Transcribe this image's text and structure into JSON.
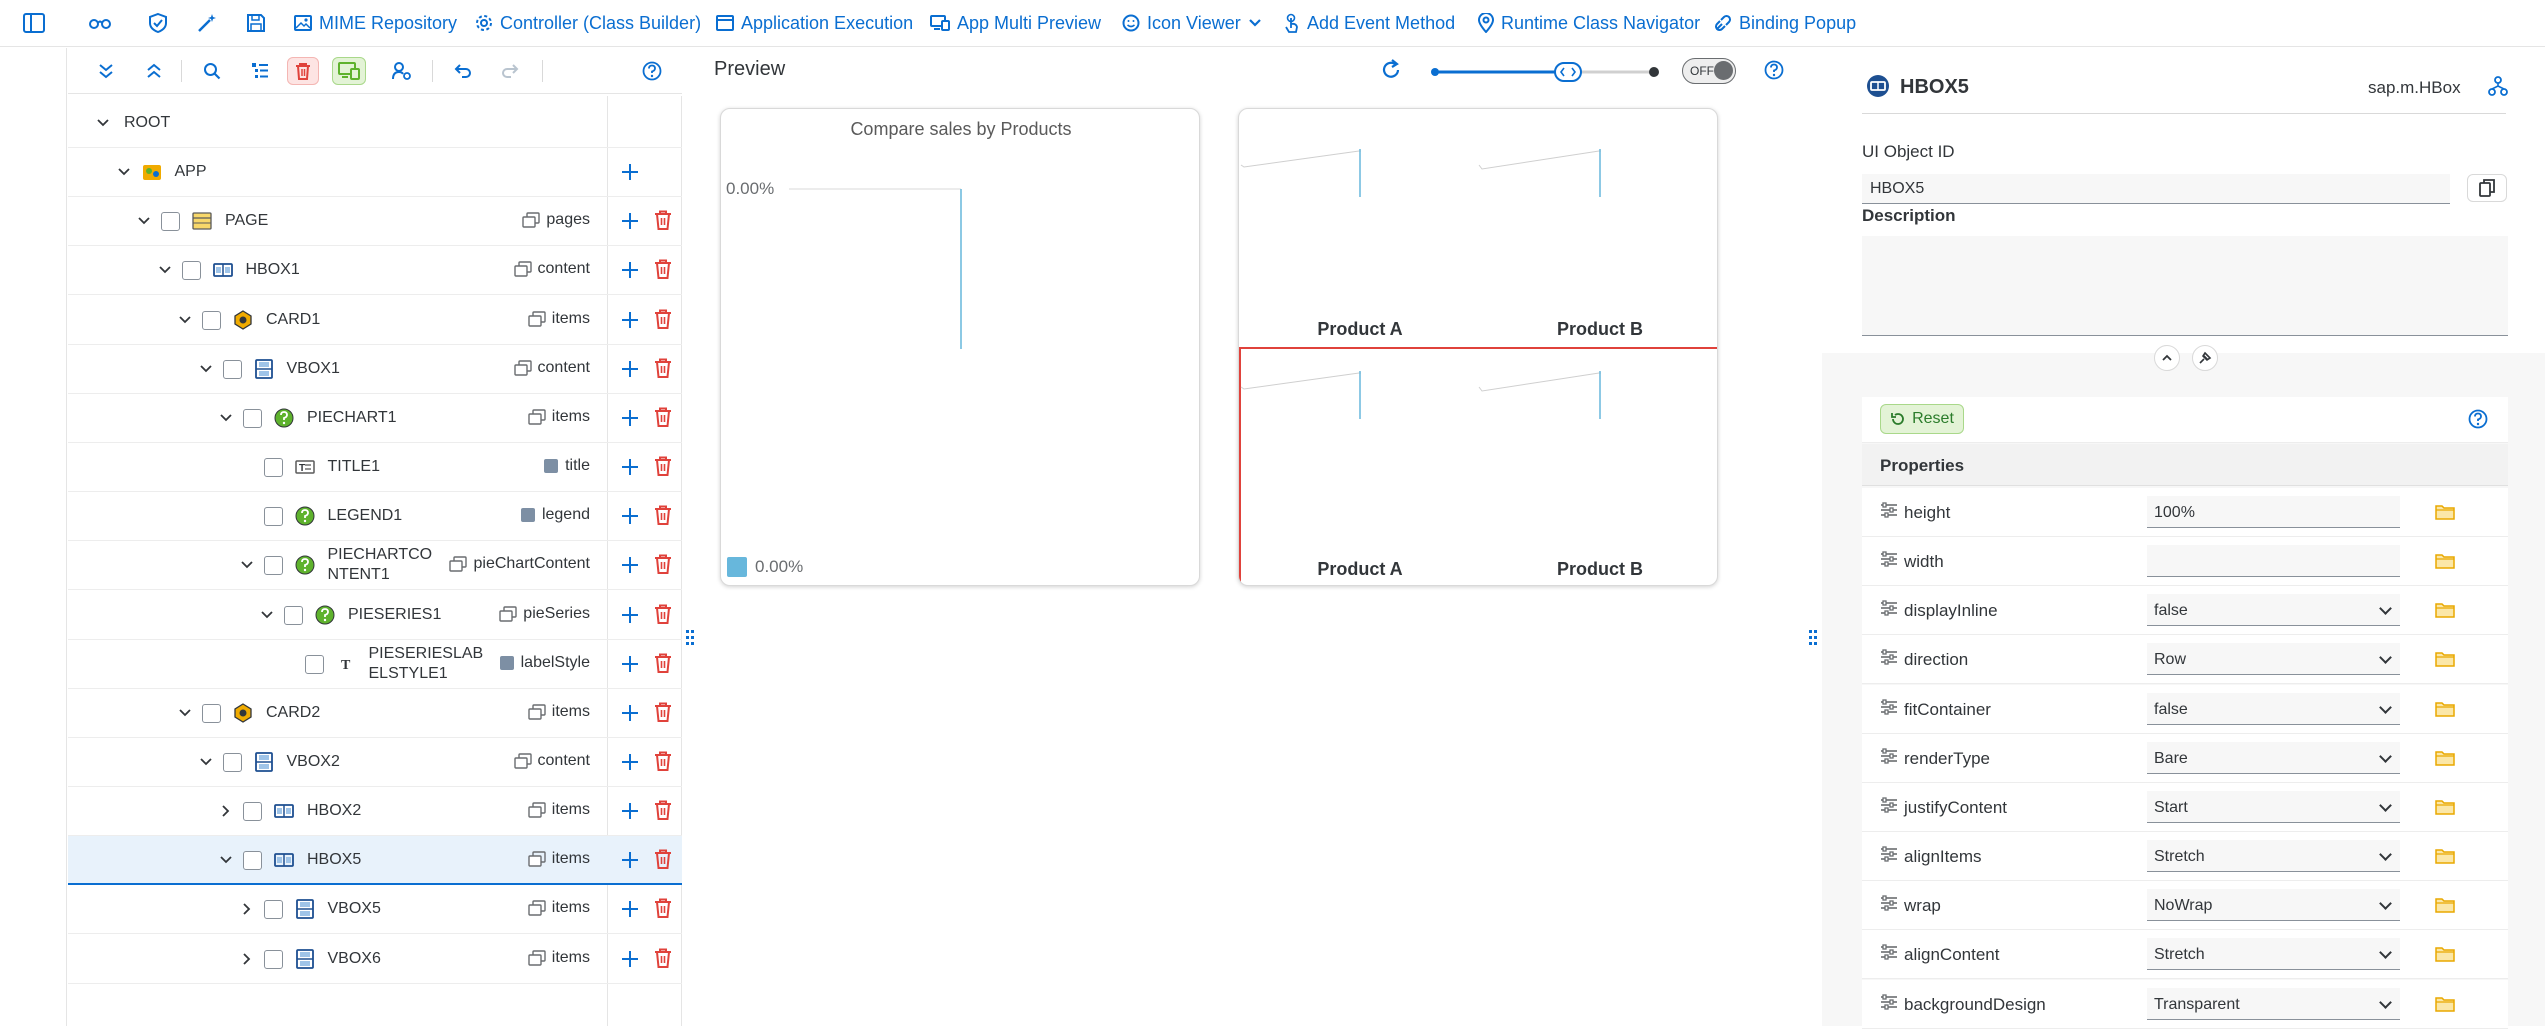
{
  "colors": {
    "brand": "#0a6ed1",
    "danger": "#e0423b",
    "green": "#5eb22d",
    "selected_bg": "#e8f2fb"
  },
  "toolbar": {
    "items": [
      {
        "label": "MIME Repository",
        "icon": "image-icon"
      },
      {
        "label": "Controller (Class Builder)",
        "icon": "gear-icon"
      },
      {
        "label": "Application Execution",
        "icon": "window-icon"
      },
      {
        "label": "App Multi Preview",
        "icon": "devices-icon"
      },
      {
        "label": "Icon Viewer",
        "icon": "smiley-icon"
      },
      {
        "label": "Add Event Method",
        "icon": "touch-icon"
      },
      {
        "label": "Runtime Class Navigator",
        "icon": "location-icon"
      },
      {
        "label": "Binding Popup",
        "icon": "link-icon"
      }
    ]
  },
  "tree": {
    "rows": [
      {
        "name": "ROOT",
        "agg": ""
      },
      {
        "name": "APP",
        "agg": ""
      },
      {
        "name": "PAGE",
        "agg": "pages"
      },
      {
        "name": "HBOX1",
        "agg": "content"
      },
      {
        "name": "CARD1",
        "agg": "items"
      },
      {
        "name": "VBOX1",
        "agg": "content"
      },
      {
        "name": "PIECHART1",
        "agg": "items"
      },
      {
        "name": "TITLE1",
        "agg": "title"
      },
      {
        "name": "LEGEND1",
        "agg": "legend"
      },
      {
        "name": "PIECHARTCONTENT1",
        "name_l1": "PIECHARTCO",
        "name_l2": "NTENT1",
        "agg": "pieChartContent"
      },
      {
        "name": "PIESERIES1",
        "agg": "pieSeries"
      },
      {
        "name": "PIESERIESLABELSTYLE1",
        "name_l1": "PIESERIESLAB",
        "name_l2": "ELSTYLE1",
        "agg": "labelStyle"
      },
      {
        "name": "CARD2",
        "agg": "items"
      },
      {
        "name": "VBOX2",
        "agg": "content"
      },
      {
        "name": "HBOX2",
        "agg": "items"
      },
      {
        "name": "HBOX5",
        "agg": "items"
      },
      {
        "name": "VBOX5",
        "agg": "items"
      },
      {
        "name": "VBOX6",
        "agg": "items"
      }
    ]
  },
  "preview": {
    "title": "Preview",
    "toggle": "OFF",
    "card1": {
      "title": "Compare sales by Products",
      "axis_label": "0.00%",
      "legend_label": "0.00%"
    },
    "card2": {
      "labels": [
        "Product A",
        "Product B",
        "Product A",
        "Product B"
      ]
    }
  },
  "chart_data": {
    "type": "pie",
    "title": "Compare sales by Products",
    "categories": [
      "0.00%"
    ],
    "values": [
      0.0
    ]
  },
  "details": {
    "object_name": "HBOX5",
    "object_class": "sap.m.HBox",
    "ui_object_id_label": "UI Object ID",
    "ui_object_id_value": "HBOX5",
    "description_label": "Description",
    "description_value": "",
    "reset_label": "Reset",
    "properties_label": "Properties",
    "properties": [
      {
        "name": "height",
        "value": "100%",
        "type": "input"
      },
      {
        "name": "width",
        "value": "",
        "type": "input"
      },
      {
        "name": "displayInline",
        "value": "false",
        "type": "select"
      },
      {
        "name": "direction",
        "value": "Row",
        "type": "select"
      },
      {
        "name": "fitContainer",
        "value": "false",
        "type": "select"
      },
      {
        "name": "renderType",
        "value": "Bare",
        "type": "select"
      },
      {
        "name": "justifyContent",
        "value": "Start",
        "type": "select"
      },
      {
        "name": "alignItems",
        "value": "Stretch",
        "type": "select"
      },
      {
        "name": "wrap",
        "value": "NoWrap",
        "type": "select"
      },
      {
        "name": "alignContent",
        "value": "Stretch",
        "type": "select"
      },
      {
        "name": "backgroundDesign",
        "value": "Transparent",
        "type": "select"
      }
    ]
  }
}
